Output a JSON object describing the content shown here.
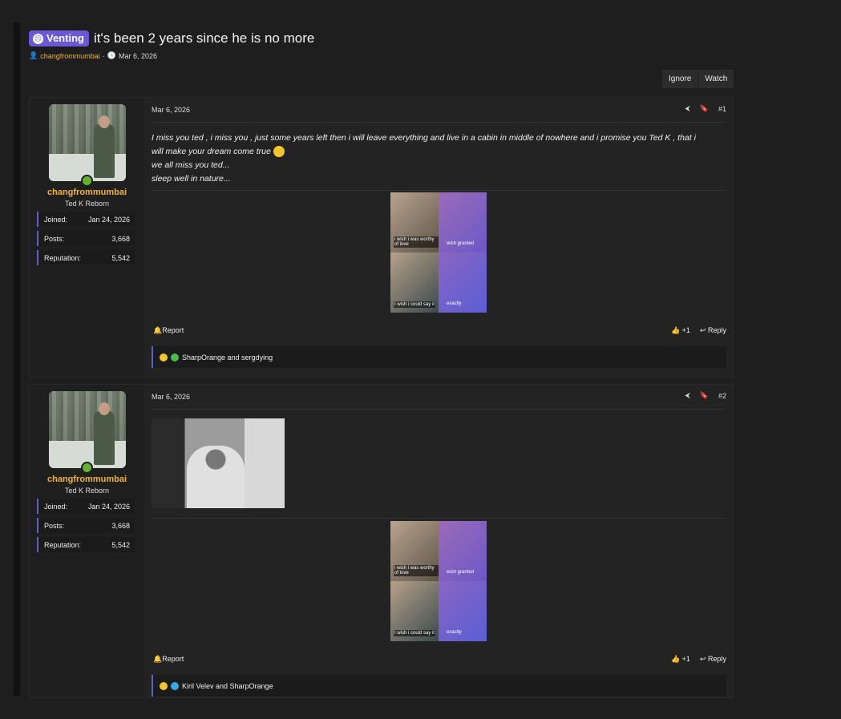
{
  "thread": {
    "prefix": "Venting",
    "title": "it's been 2 years since he is no more",
    "author": "changfrommumbai",
    "date": "Mar 6, 2026",
    "separator": "·"
  },
  "thread_actions": {
    "ignore": "Ignore",
    "watch": "Watch"
  },
  "labels": {
    "joined": "Joined:",
    "posts": "Posts:",
    "reputation": "Reputation:",
    "report": "Report",
    "reply": "Reply",
    "like_count": "+1"
  },
  "posts": [
    {
      "number": "#1",
      "date": "Mar 6, 2026",
      "user": {
        "name": "changfrommumbai",
        "title": "Ted K Reborn",
        "joined": "Jan 24, 2026",
        "posts": "3,668",
        "reputation": "5,542"
      },
      "message_lines": [
        "I miss you ted , i miss you , just some years left then i will leave everything and live in a cabin in middle of nowhere and i promise you Ted K , that i",
        "will make your dream come true",
        "we all miss you ted...",
        "sleep well in nature..."
      ],
      "meme_captions": [
        "i wish i was worthy of love",
        "wish granted",
        "I wish i could say it",
        "exactly"
      ],
      "reactions": "SharpOrange and sergdying"
    },
    {
      "number": "#2",
      "date": "Mar 6, 2026",
      "user": {
        "name": "changfrommumbai",
        "title": "Ted K Reborn",
        "joined": "Jan 24, 2026",
        "posts": "3,668",
        "reputation": "5,542"
      },
      "meme_captions": [
        "i wish i was worthy of love",
        "wish granted",
        "I wish i could say it",
        "exactly"
      ],
      "reactions": "Kiril Velev and SharpOrange"
    }
  ]
}
